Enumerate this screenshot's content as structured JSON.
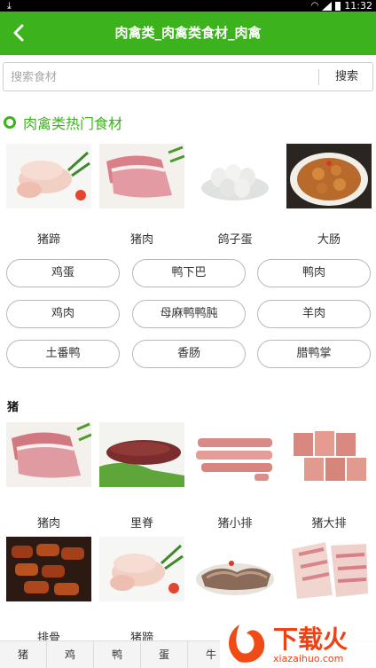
{
  "status_bar": {
    "time": "11:32"
  },
  "header": {
    "title": "肉禽类_肉禽类食材_肉禽"
  },
  "search": {
    "placeholder": "搜索食材",
    "button_label": "搜索"
  },
  "hot_section": {
    "title": "肉禽类热门食材",
    "items": [
      {
        "label": "猪蹄",
        "icon": "pig-trotter-photo"
      },
      {
        "label": "猪肉",
        "icon": "pork-photo"
      },
      {
        "label": "鸽子蛋",
        "icon": "pigeon-egg-photo"
      },
      {
        "label": "大肠",
        "icon": "intestine-photo"
      }
    ],
    "tags": [
      "鸡蛋",
      "鸭下巴",
      "鸭肉",
      "鸡肉",
      "母麻鸭鸭肫",
      "羊肉",
      "土番鸭",
      "香肠",
      "腊鸭掌"
    ]
  },
  "category": {
    "title": "猪",
    "items": [
      {
        "label": "猪肉",
        "icon": "pork-photo"
      },
      {
        "label": "里脊",
        "icon": "tenderloin-photo"
      },
      {
        "label": "猪小排",
        "icon": "small-ribs-photo"
      },
      {
        "label": "猪大排",
        "icon": "big-ribs-photo"
      },
      {
        "label": "排骨",
        "icon": "braised-ribs-photo"
      },
      {
        "label": "猪蹄",
        "icon": "pig-trotter-photo"
      },
      {
        "label": "",
        "icon": "pig-ear-photo"
      },
      {
        "label": "",
        "icon": "pork-belly-photo"
      }
    ]
  },
  "bottom_nav": [
    "猪",
    "鸡",
    "鸭",
    "蛋",
    "牛"
  ],
  "watermark": {
    "brand": "下载火",
    "url": "xiazaihuo.com"
  }
}
